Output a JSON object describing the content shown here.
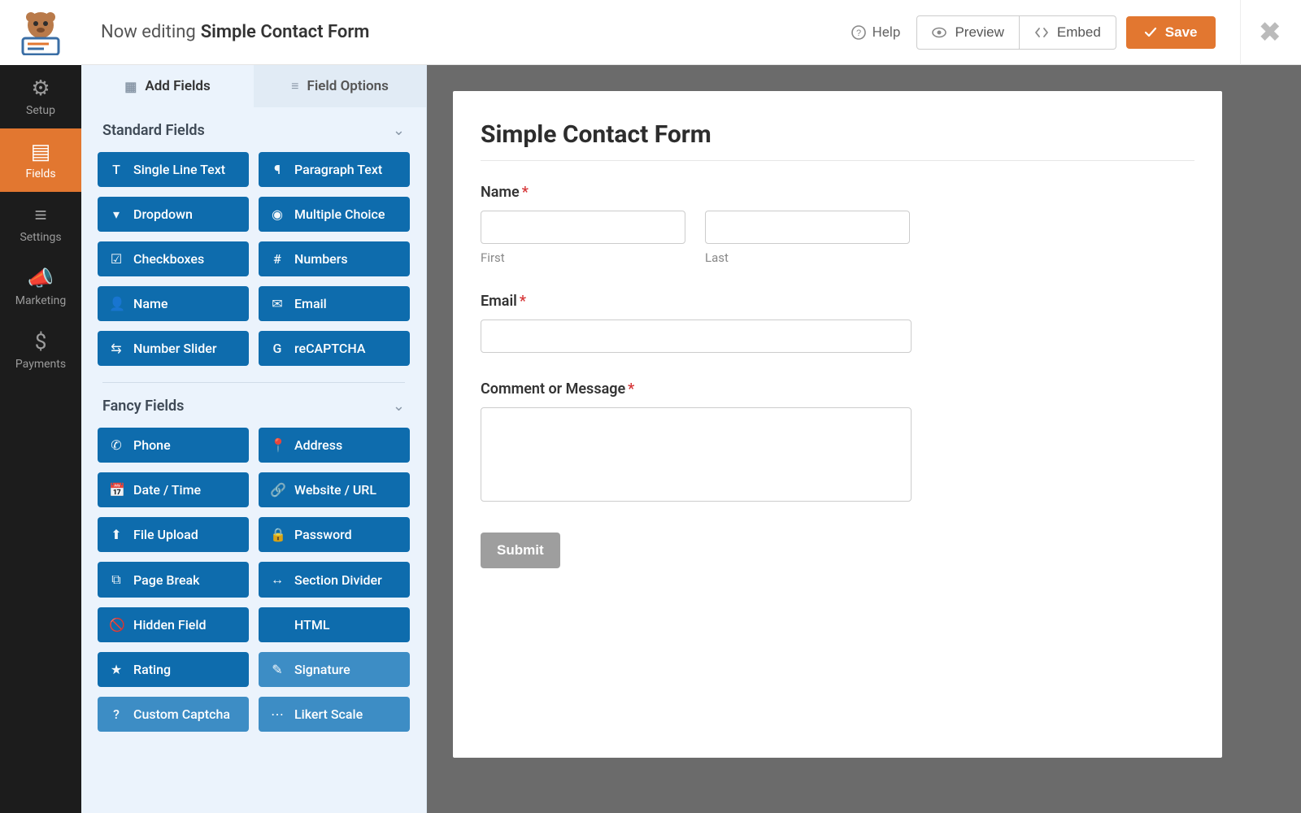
{
  "topbar": {
    "prefix": "Now editing",
    "form_name": "Simple Contact Form",
    "help": "Help",
    "preview": "Preview",
    "embed": "Embed",
    "save": "Save"
  },
  "rail": {
    "items": [
      {
        "label": "Setup",
        "icon": "⚙"
      },
      {
        "label": "Fields",
        "icon": "▤"
      },
      {
        "label": "Settings",
        "icon": "≡"
      },
      {
        "label": "Marketing",
        "icon": "📣"
      },
      {
        "label": "Payments",
        "icon": "$"
      }
    ],
    "active_index": 1
  },
  "panel": {
    "tabs": {
      "add": "Add Fields",
      "options": "Field Options"
    },
    "sections": [
      {
        "title": "Standard Fields",
        "fields": [
          {
            "label": "Single Line Text",
            "icon": "T"
          },
          {
            "label": "Paragraph Text",
            "icon": "¶"
          },
          {
            "label": "Dropdown",
            "icon": "▾"
          },
          {
            "label": "Multiple Choice",
            "icon": "◉"
          },
          {
            "label": "Checkboxes",
            "icon": "☑"
          },
          {
            "label": "Numbers",
            "icon": "#"
          },
          {
            "label": "Name",
            "icon": "👤"
          },
          {
            "label": "Email",
            "icon": "✉"
          },
          {
            "label": "Number Slider",
            "icon": "⇆"
          },
          {
            "label": "reCAPTCHA",
            "icon": "G"
          }
        ]
      },
      {
        "title": "Fancy Fields",
        "fields": [
          {
            "label": "Phone",
            "icon": "✆"
          },
          {
            "label": "Address",
            "icon": "📍"
          },
          {
            "label": "Date / Time",
            "icon": "📅"
          },
          {
            "label": "Website / URL",
            "icon": "🔗"
          },
          {
            "label": "File Upload",
            "icon": "⬆"
          },
          {
            "label": "Password",
            "icon": "🔒"
          },
          {
            "label": "Page Break",
            "icon": "⧉"
          },
          {
            "label": "Section Divider",
            "icon": "↔"
          },
          {
            "label": "Hidden Field",
            "icon": "🚫"
          },
          {
            "label": "HTML",
            "icon": "</>"
          },
          {
            "label": "Rating",
            "icon": "★"
          },
          {
            "label": "Signature",
            "icon": "✎",
            "light": true
          },
          {
            "label": "Custom Captcha",
            "icon": "?",
            "light": true
          },
          {
            "label": "Likert Scale",
            "icon": "⋯",
            "light": true
          }
        ]
      }
    ]
  },
  "form": {
    "title": "Simple Contact Form",
    "name_label": "Name",
    "first_sub": "First",
    "last_sub": "Last",
    "email_label": "Email",
    "comment_label": "Comment or Message",
    "submit": "Submit"
  }
}
